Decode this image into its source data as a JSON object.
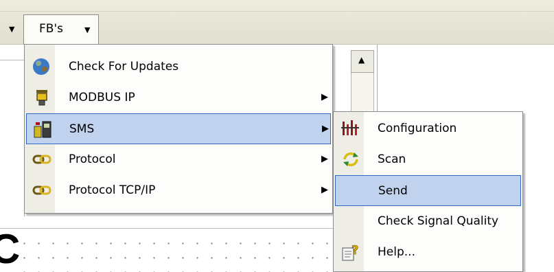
{
  "toolbar": {
    "fbs_label": "FB's"
  },
  "menu": {
    "items": [
      {
        "label": "Check For Updates",
        "icon": "globe-icon",
        "has_submenu": false
      },
      {
        "label": "MODBUS IP",
        "icon": "modbus-device-icon",
        "has_submenu": true
      },
      {
        "label": "SMS",
        "icon": "sms-phone-icon",
        "has_submenu": true,
        "highlighted": true
      },
      {
        "label": "Protocol",
        "icon": "link-chain-icon",
        "has_submenu": true
      },
      {
        "label": "Protocol TCP/IP",
        "icon": "link-chain-icon",
        "has_submenu": true
      }
    ]
  },
  "submenu": {
    "items": [
      {
        "label": "Configuration",
        "icon": "config-bars-icon"
      },
      {
        "label": "Scan",
        "icon": "scan-arrows-icon"
      },
      {
        "label": "Send",
        "icon": "",
        "highlighted": true
      },
      {
        "label": "Check Signal Quality",
        "icon": ""
      },
      {
        "label": "Help...",
        "icon": "help-document-icon"
      }
    ]
  },
  "colors": {
    "highlight_fill": "#c1d2ee",
    "highlight_border": "#316ac5",
    "menu_gutter": "#eeede6",
    "toolbar_bg": "#e7e5d6"
  }
}
